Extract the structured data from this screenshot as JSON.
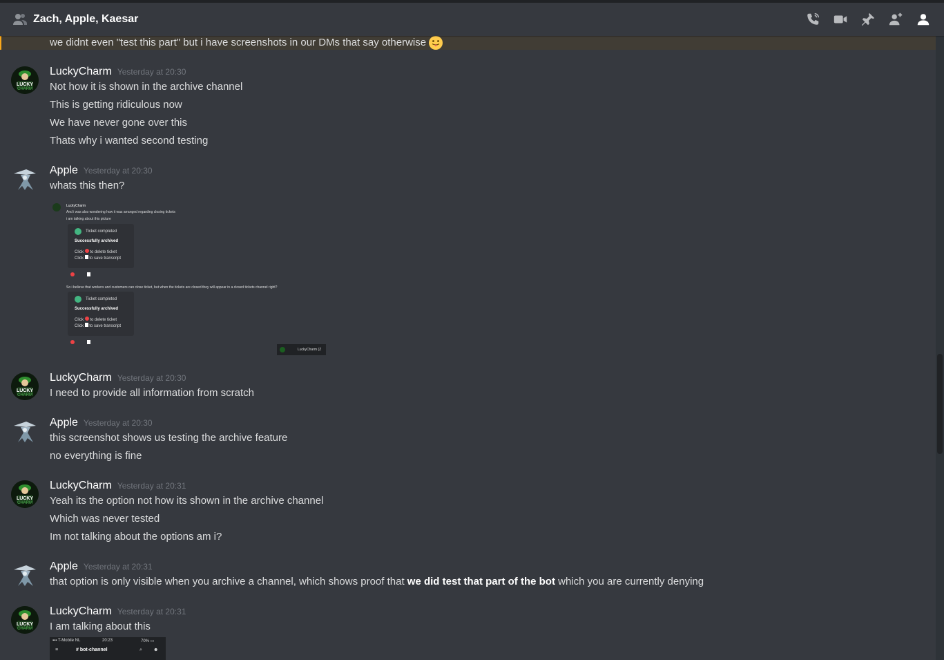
{
  "header": {
    "title": "Zach, Apple, Kaesar",
    "icons": [
      "group-dm-icon",
      "phone-call-icon",
      "video-call-icon",
      "pin-icon",
      "add-friend-icon",
      "member-list-icon"
    ]
  },
  "highlighted": {
    "text": "we didnt even \"test this part\" but i have screenshots in our DMs that say otherwise",
    "emoji": "tongue-out-emoji"
  },
  "messages": [
    {
      "author": "LuckyCharm",
      "timestamp": "Yesterday at 20:30",
      "lines": [
        "Not how it is shown in the archive channel",
        "This is getting ridiculous now",
        "We have never gone over this",
        "Thats why i wanted second testing"
      ]
    },
    {
      "author": "Apple",
      "timestamp": "Yesterday at 20:30",
      "lines": [
        "whats this then?"
      ]
    },
    {
      "author": "LuckyCharm",
      "timestamp": "Yesterday at 20:30",
      "lines": [
        "I need to provide all information from scratch"
      ]
    },
    {
      "author": "Apple",
      "timestamp": "Yesterday at 20:30",
      "lines": [
        "this screenshot shows us testing the archive feature",
        "no everything is fine"
      ]
    },
    {
      "author": "LuckyCharm",
      "timestamp": "Yesterday at 20:31",
      "lines": [
        "Yeah its the option not how its shown in the archive channel",
        "Which was never tested",
        "Im not talking about the options am i?"
      ]
    },
    {
      "author": "Apple",
      "timestamp": "Yesterday at 20:31",
      "pre": "that option is only visible when you archive a channel, which shows proof that ",
      "bold": "we did test that part of the bot",
      "post": " which you are currently denying"
    },
    {
      "author": "LuckyCharm",
      "timestamp": "Yesterday at 20:31",
      "lines": [
        "I am talking about this"
      ]
    }
  ],
  "attachment1": {
    "author": "LuckyCharm",
    "line1": "And i was also wondering how it was arranged regarding closing tickets",
    "line2": "i am talking about this picture",
    "card_title": "Ticket completed",
    "card_status": "Successfully archived",
    "card_delete": "to delete ticket",
    "card_save": "to save transcript",
    "click": "Click",
    "middle": "So i believe that workers and customers can close ticket, but when the tickets are closed they will appear in a closed tickets channel right?",
    "footer": "LuckyCharm (Z"
  },
  "attachment2": {
    "carrier": "T-Mobile NL",
    "time": "20:23",
    "battery": "70%",
    "channel": "bot-channel"
  }
}
